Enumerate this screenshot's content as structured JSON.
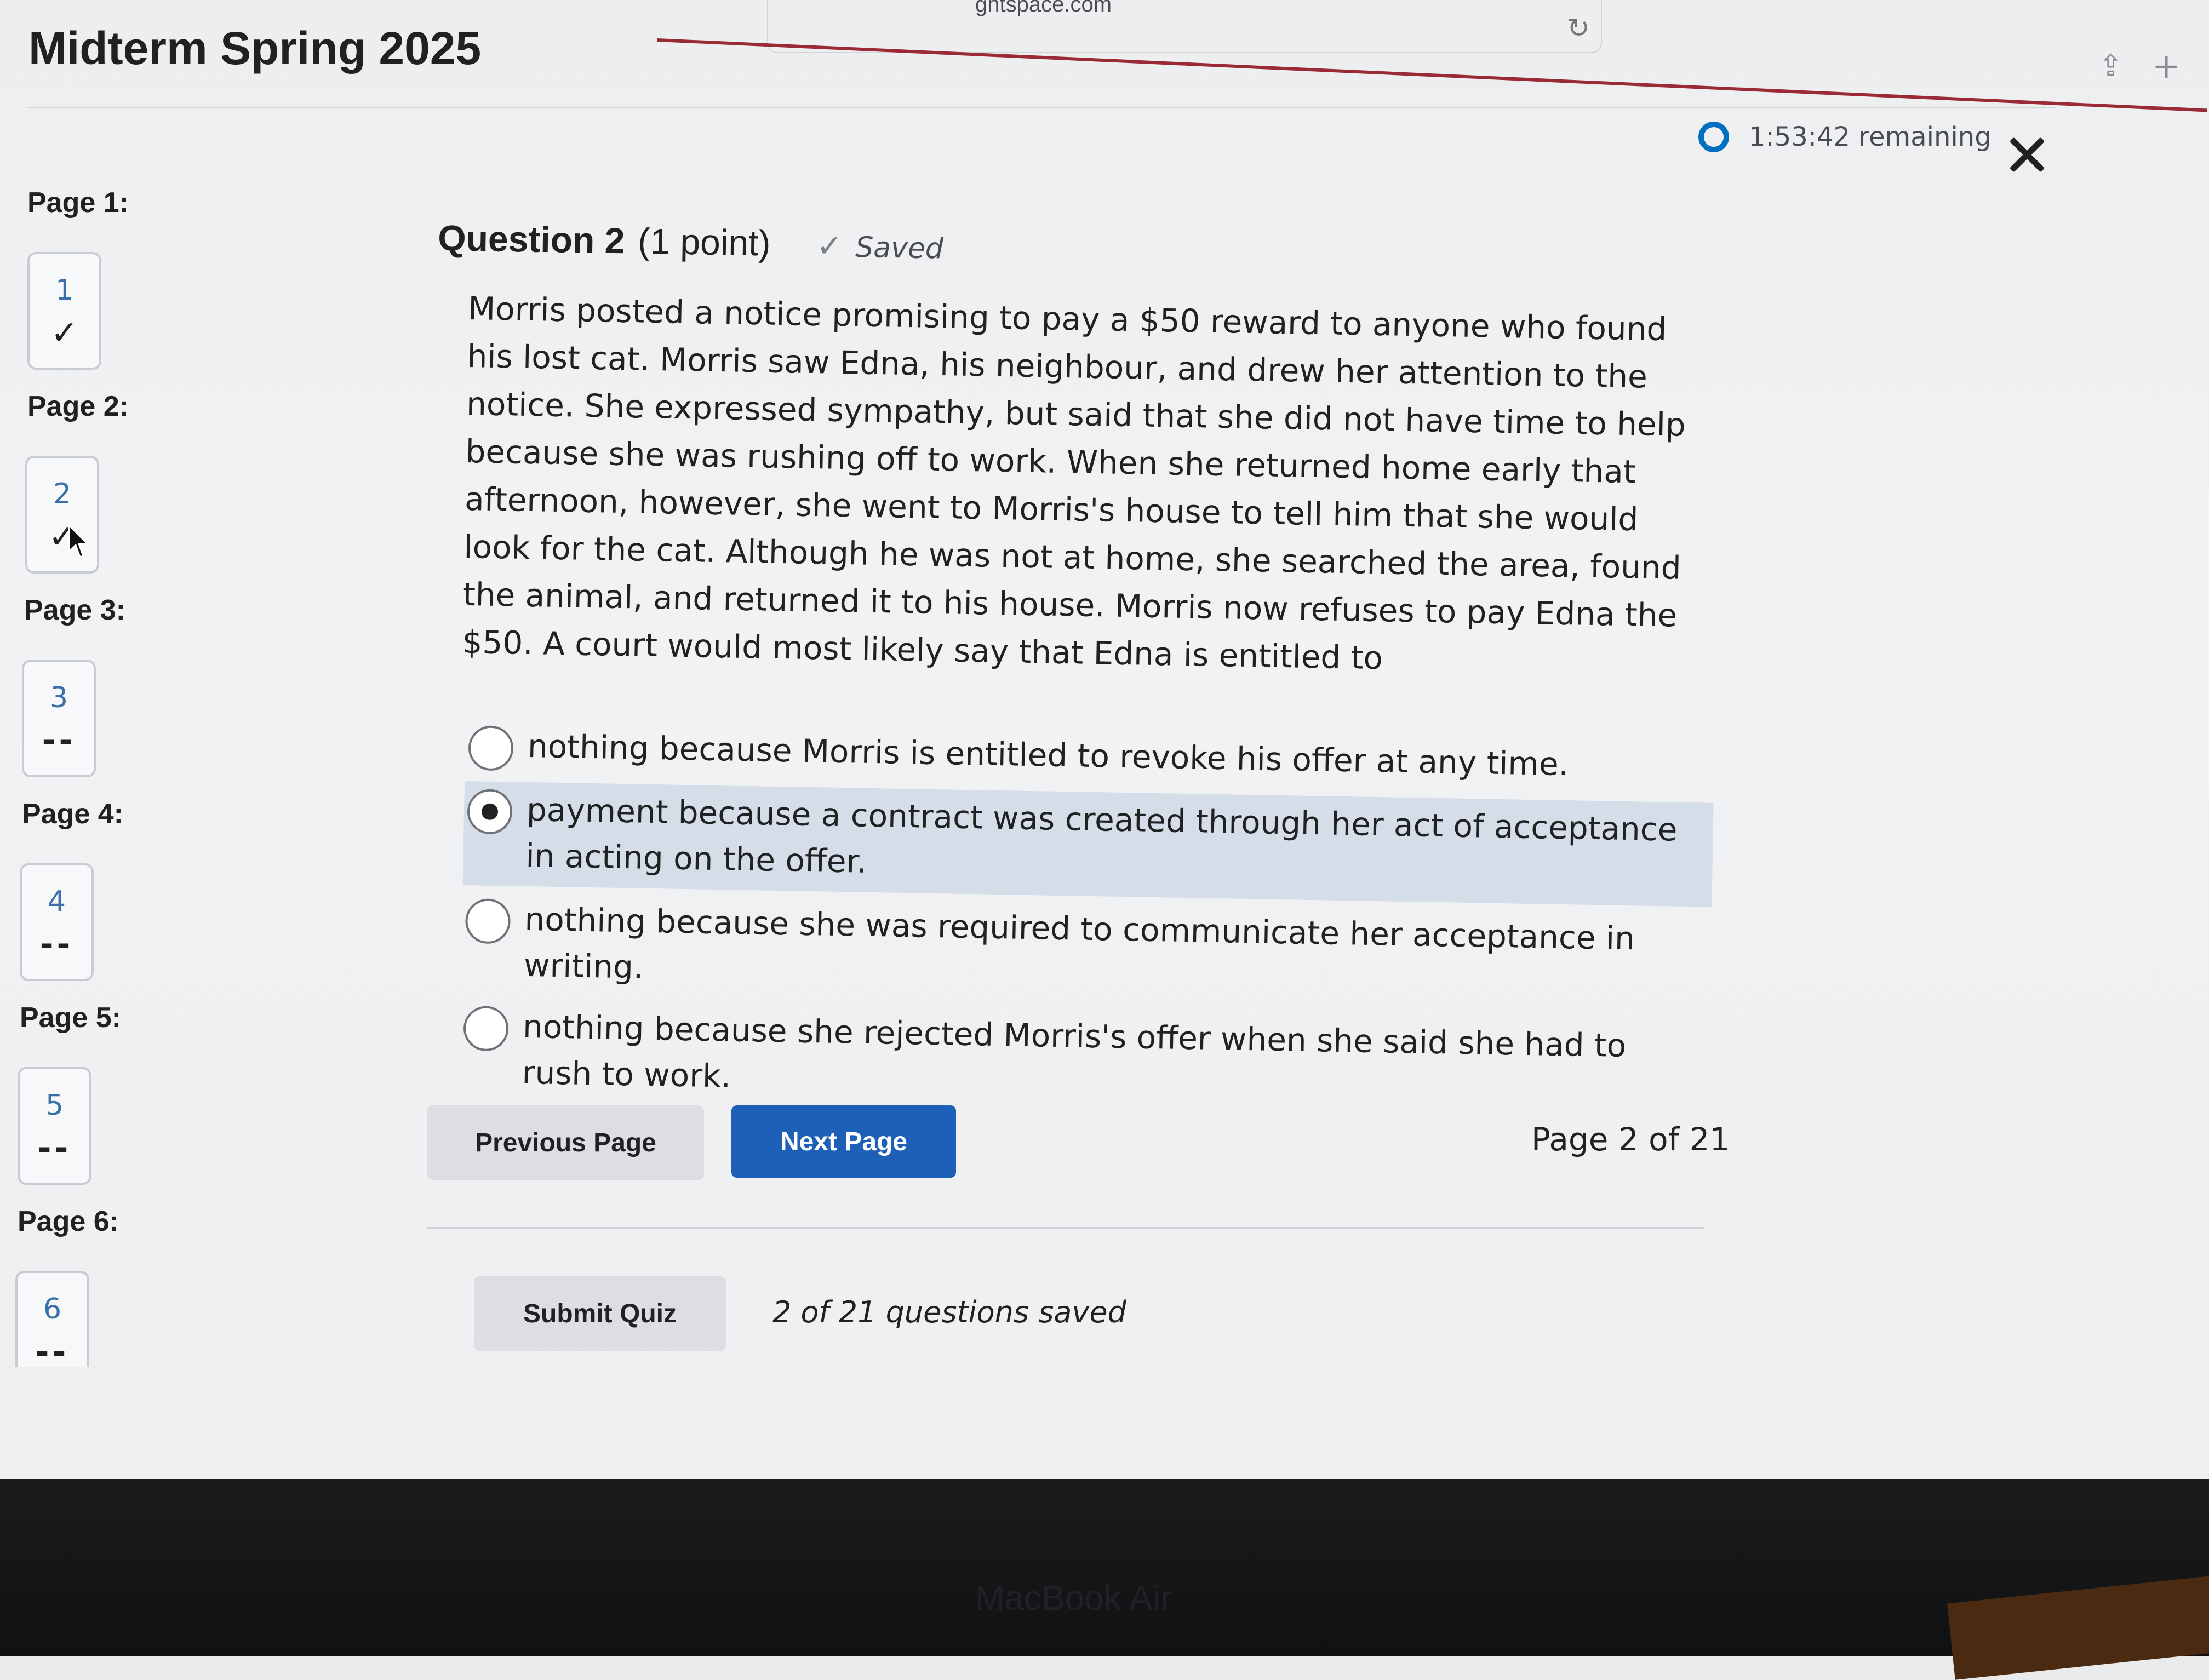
{
  "browser": {
    "url_fragment": "ghtspace.com"
  },
  "page": {
    "title": "Midterm Spring 2025"
  },
  "timer": {
    "text": "1:53:42 remaining"
  },
  "sidebar": {
    "pages": [
      {
        "label": "Page 1:",
        "number": "1",
        "status": "✓"
      },
      {
        "label": "Page 2:",
        "number": "2",
        "status": "✓"
      },
      {
        "label": "Page 3:",
        "number": "3",
        "status": "--"
      },
      {
        "label": "Page 4:",
        "number": "4",
        "status": "--"
      },
      {
        "label": "Page 5:",
        "number": "5",
        "status": "--"
      },
      {
        "label": "Page 6:",
        "number": "6",
        "status": "--"
      }
    ]
  },
  "question": {
    "title": "Question 2",
    "points": "(1 point)",
    "status": "Saved",
    "stem": "Morris posted a notice promising to pay a $50 reward to anyone who found his lost cat. Morris saw Edna, his neighbour, and drew her attention to the notice. She expressed sympathy, but said that she did not have time to help because she was rushing off to work. When she returned home early that afternoon, however, she went to Morris's house to tell him that she would look for the cat. Although he was not at home, she searched the area, found the animal, and returned it to his house. Morris now refuses to pay Edna the $50. A court would most likely say that Edna is entitled to",
    "options": [
      {
        "text": "nothing because Morris is entitled to revoke his offer at any time.",
        "selected": false
      },
      {
        "text": "payment because a contract was created through her act of acceptance in acting on the offer.",
        "selected": true
      },
      {
        "text": "nothing because she was required to communicate her acceptance in writing.",
        "selected": false
      },
      {
        "text": "nothing because she rejected Morris's offer when she said she had to rush to work.",
        "selected": false
      }
    ]
  },
  "nav": {
    "previous_label": "Previous Page",
    "next_label": "Next Page",
    "page_indicator": "Page 2 of 21"
  },
  "footer": {
    "submit_label": "Submit Quiz",
    "saved_count": "2 of 21 questions saved"
  },
  "device": {
    "label": "MacBook Air"
  },
  "colors": {
    "accent": "#1e5fb8",
    "timer_ring": "#006fbf",
    "header_rule": "#9a2a35",
    "selected_option_bg": "#d5dde8"
  }
}
